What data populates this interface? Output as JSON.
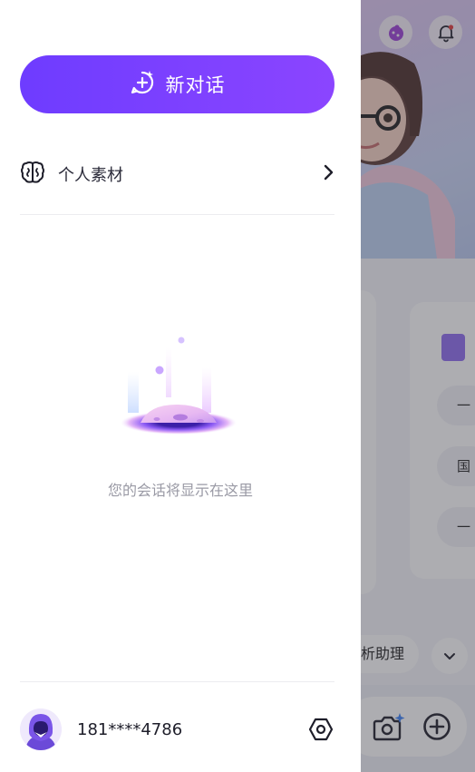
{
  "drawer": {
    "new_chat_label": "新对话",
    "materials_label": "个人素材",
    "empty_text": "您的会话将显示在这里",
    "user_phone": "181****4786"
  },
  "background": {
    "chips": [
      "一",
      "国",
      "一"
    ],
    "assistant_pill": "析助理"
  },
  "colors": {
    "accent_start": "#6e3cff",
    "accent_end": "#8b45ff",
    "scrim": "rgba(60,60,70,0.42)"
  },
  "icons": {
    "new_chat": "chat-sparkle-icon",
    "materials": "brain-icon",
    "materials_arrow": "chevron-right-icon",
    "settings": "hexagon-settings-icon",
    "notifications": "bell-icon",
    "camera": "camera-sparkle-icon",
    "add": "plus-circle-icon",
    "expand": "chevron-down-icon"
  }
}
